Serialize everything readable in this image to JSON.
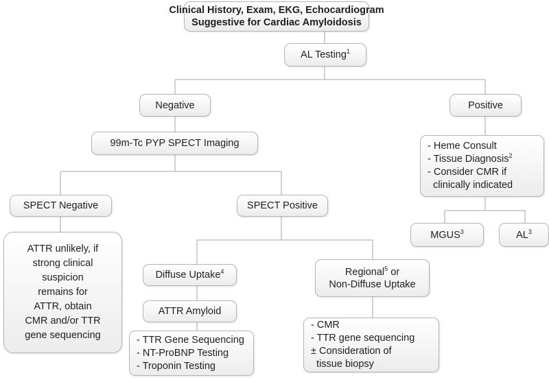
{
  "nodes": {
    "root": {
      "lines": [
        "Clinical History, Exam, EKG, Echocardiogram",
        "Suggestive for Cardiac Amyloidosis"
      ]
    },
    "al_testing": {
      "text": "AL Testing",
      "sup": "1"
    },
    "negative": {
      "text": "Negative"
    },
    "positive": {
      "text": "Positive"
    },
    "pyp": {
      "text": "99m-Tc PYP SPECT Imaging"
    },
    "positive_actions": {
      "lines": [
        "- Heme Consult",
        "- Tissue Diagnosis",
        "- Consider CMR if",
        "  clinically indicated"
      ],
      "sup1": "2"
    },
    "mgus": {
      "text": "MGUS",
      "sup": "3"
    },
    "al": {
      "text": "AL",
      "sup": "3"
    },
    "spect_negative": {
      "text": "SPECT Negative"
    },
    "spect_positive": {
      "text": "SPECT Positive"
    },
    "attr_unlikely": {
      "lines": [
        "ATTR unlikely, if",
        "strong clinical",
        "suspicion",
        "remains for",
        "ATTR, obtain",
        "CMR and/or TTR",
        "gene sequencing"
      ]
    },
    "diffuse": {
      "text": "Diffuse Uptake",
      "sup": "4"
    },
    "regional": {
      "text": "Regional",
      "sup": "5",
      "text2": " or",
      "line2": "Non-Diffuse Uptake"
    },
    "attr_amyloid": {
      "text": "ATTR Amyloid"
    },
    "attr_actions": {
      "lines": [
        "- TTR Gene Sequencing",
        "- NT-ProBNP Testing",
        "- Troponin Testing"
      ]
    },
    "regional_actions": {
      "lines": [
        "- CMR",
        "- TTR gene sequencing",
        "± Consideration of",
        "  tissue biopsy"
      ]
    }
  },
  "colors": {
    "border": "#b5b5b5",
    "connector": "#b8b8b8",
    "text": "#1e1e1e"
  }
}
